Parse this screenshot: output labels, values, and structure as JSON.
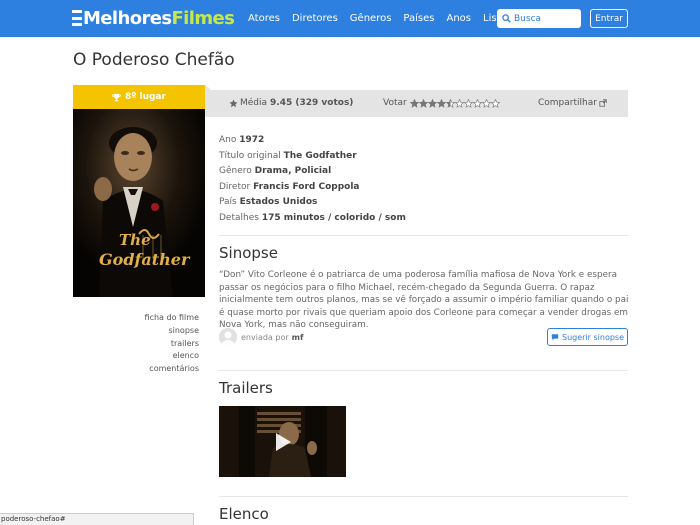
{
  "header": {
    "logo_part1": "Melhores",
    "logo_part2": "Filmes",
    "nav": [
      "Atores",
      "Diretores",
      "Gêneros",
      "Países",
      "Anos",
      "Listas"
    ],
    "search_placeholder": "Busca",
    "login_label": "Entrar",
    "colors": {
      "bar": "#2d7fe0",
      "logo_accent": "#c6e84a"
    }
  },
  "movie": {
    "title": "O Poderoso Chefão",
    "rank": "8º lugar",
    "poster_title_line1": "The",
    "poster_title_line2": "Godfather"
  },
  "rating": {
    "average_label": "Média",
    "average_value": "9.45 (329 votos)",
    "vote_label": "Votar",
    "stars_filled": 4.5,
    "stars_total": 10,
    "share_label": "Compartilhar"
  },
  "details": [
    {
      "label": "Ano",
      "value": "1972"
    },
    {
      "label": "Título original",
      "value": "The Godfather"
    },
    {
      "label": "Gênero",
      "value": "Drama, Policial"
    },
    {
      "label": "Diretor",
      "value": "Francis Ford Coppola"
    },
    {
      "label": "País",
      "value": "Estados Unidos"
    },
    {
      "label": "Detalhes",
      "value": "175 minutos / colorido / som"
    }
  ],
  "synopsis": {
    "heading": "Sinopse",
    "text": "“Don” Vito Corleone é o patriarca de uma poderosa família mafiosa de Nova York e espera passar os negócios para o filho Michael, recém-chegado da Segunda Guerra. O rapaz inicialmente tem outros planos, mas se vê forçado a assumir o império familiar quando o pai é quase morto por rivais que queriam apoio dos Corleone para começar a vender drogas em Nova York, mas não conseguiram.",
    "sent_by_label": "enviada por",
    "sent_by_user": "mf",
    "suggest_label": "Sugerir sinopse"
  },
  "sidebar_links": [
    "ficha do filme",
    "sinopse",
    "trailers",
    "elenco",
    "comentários"
  ],
  "trailers_heading": "Trailers",
  "cast_heading": "Elenco",
  "status_url": "poderoso-chefao#"
}
